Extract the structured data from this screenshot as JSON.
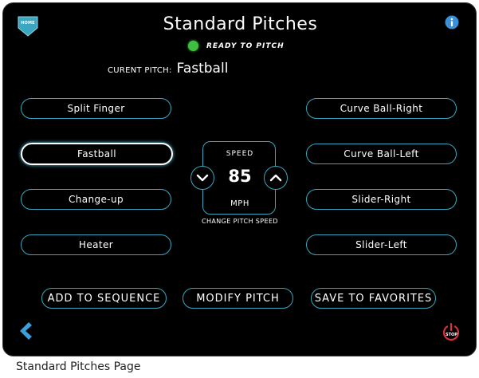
{
  "header": {
    "title": "Standard Pitches",
    "home_label": "HOME",
    "info_icon": "info-icon",
    "status_text": "READY TO PITCH",
    "status_color": "#3fbf3f"
  },
  "current_pitch": {
    "label": "CURENT PITCH:",
    "value": "Fastball"
  },
  "pitches_left": [
    "Split Finger",
    "Fastball",
    "Change-up",
    "Heater"
  ],
  "pitches_right": [
    "Curve Ball-Right",
    "Curve Ball-Left",
    "Slider-Right",
    "Slider-Left"
  ],
  "selected_pitch": "Fastball",
  "speed": {
    "label": "SPEED",
    "value": "85",
    "unit": "MPH",
    "caption": "CHANGE PITCH SPEED",
    "decrease_icon": "chevron-down-icon",
    "increase_icon": "chevron-up-icon"
  },
  "actions": {
    "add_to_sequence": "ADD TO SEQUENCE",
    "modify_pitch": "MODIFY PITCH",
    "save_to_favorites": "SAVE TO FAVORITES"
  },
  "footer": {
    "back_icon": "chevron-left-icon",
    "stop_label": "STOP"
  },
  "colors": {
    "accent": "#3aa6bf",
    "background": "#000000",
    "stop_red": "#d8323c"
  },
  "caption": "Standard Pitches Page"
}
